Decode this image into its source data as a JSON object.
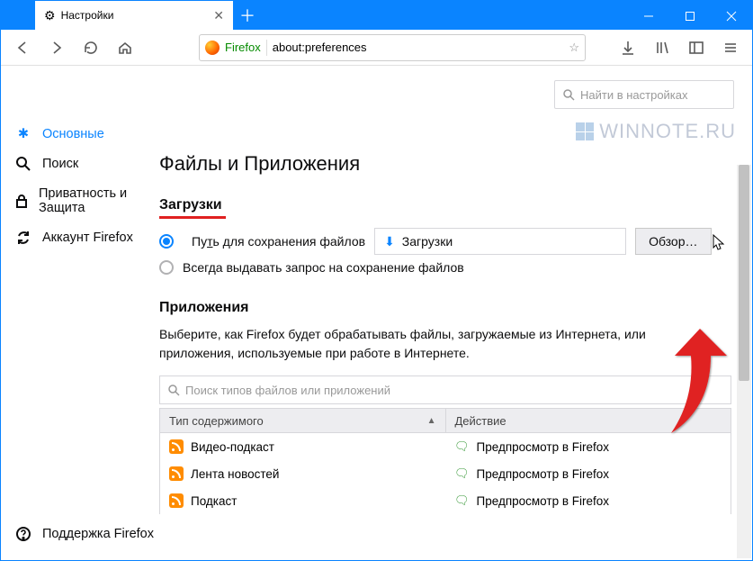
{
  "window": {
    "tab_title": "Настройки",
    "url_label": "Firefox",
    "url_value": "about:preferences"
  },
  "search": {
    "placeholder": "Найти в настройках"
  },
  "sidebar": {
    "items": [
      "Основные",
      "Поиск",
      "Приватность и Защита",
      "Аккаунт Firefox"
    ],
    "support": "Поддержка Firefox"
  },
  "section_title": "Файлы и Приложения",
  "downloads": {
    "heading": "Загрузки",
    "save_to_label_pre": "Пу",
    "save_to_label_u": "т",
    "save_to_label_post": "ь для сохранения файлов",
    "folder_name": "Загрузки",
    "browse": "Обзор…",
    "always_ask": "Всегда выдавать запрос на сохранение файлов"
  },
  "apps": {
    "heading": "Приложения",
    "desc": "Выберите, как Firefox будет обрабатывать файлы, загружаемые из Интернета, или приложения, используемые при работе в Интернете.",
    "search_placeholder": "Поиск типов файлов или приложений",
    "col_type": "Тип содержимого",
    "col_action": "Действие",
    "rows": [
      {
        "type": "Видео-подкаст",
        "action": "Предпросмотр в Firefox"
      },
      {
        "type": "Лента новостей",
        "action": "Предпросмотр в Firefox"
      },
      {
        "type": "Подкаст",
        "action": "Предпросмотр в Firefox"
      }
    ]
  },
  "watermark": "WINNOTE.RU"
}
